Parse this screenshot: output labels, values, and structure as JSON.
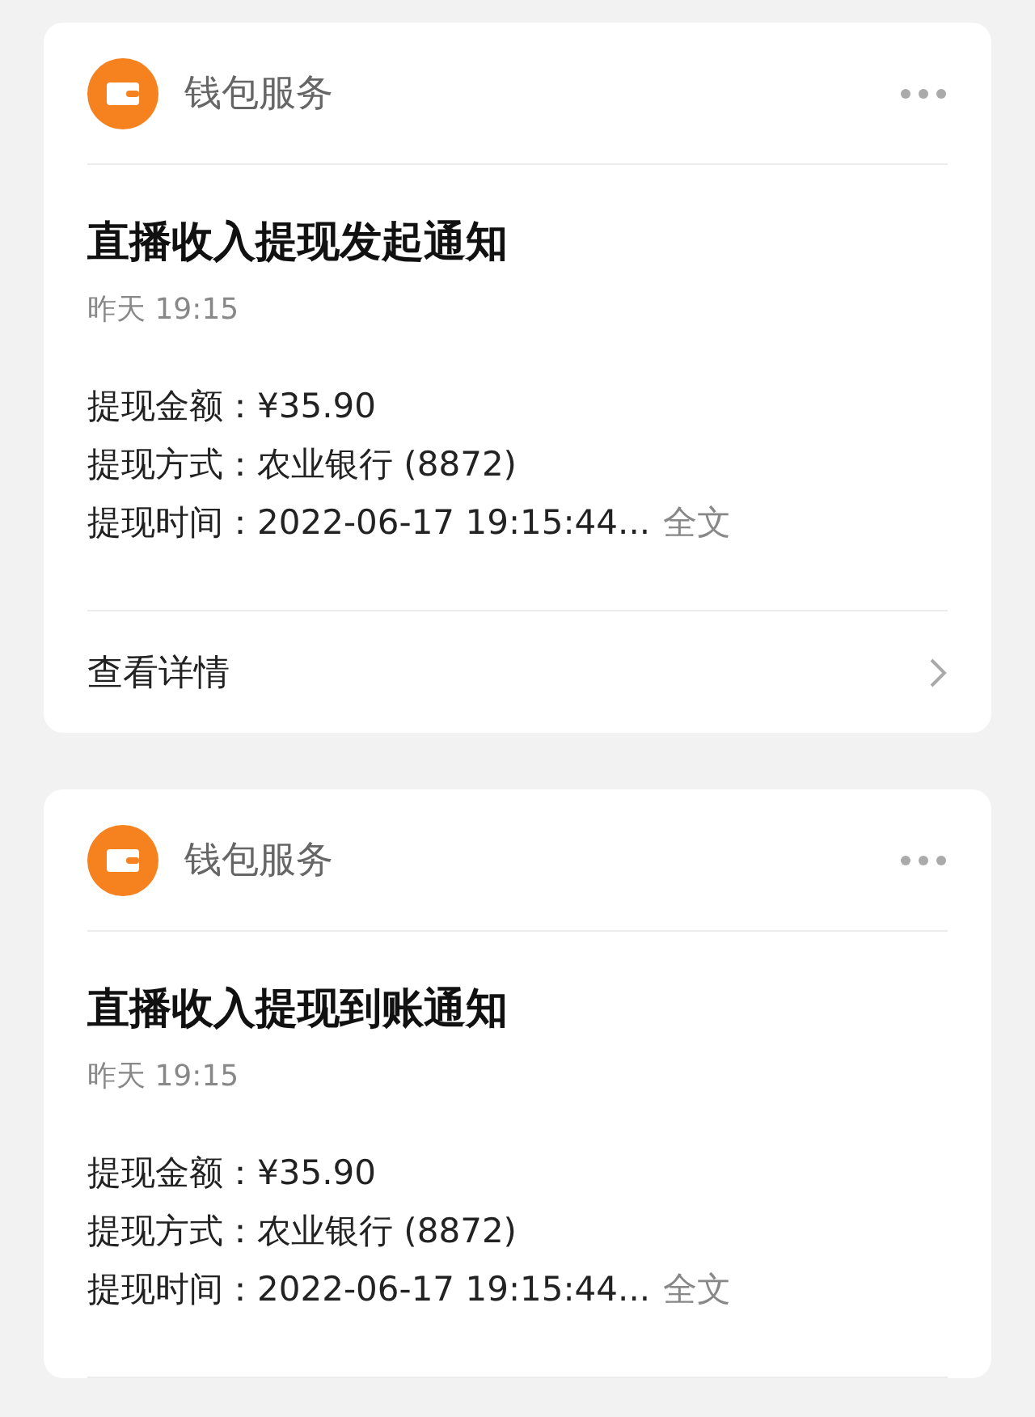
{
  "cards": [
    {
      "service": "钱包服务",
      "title": "直播收入提现发起通知",
      "time": "昨天 19:15",
      "fields": [
        {
          "label": "提现金额：",
          "value": "¥35.90"
        },
        {
          "label": "提现方式：",
          "value": "农业银行 (8872)"
        },
        {
          "label": "提现时间：",
          "value": "2022-06-17 19:15:44...",
          "more": "全文"
        }
      ],
      "footer": "查看详情"
    },
    {
      "service": "钱包服务",
      "title": "直播收入提现到账通知",
      "time": "昨天 19:15",
      "fields": [
        {
          "label": "提现金额：",
          "value": "¥35.90"
        },
        {
          "label": "提现方式：",
          "value": "农业银行 (8872)"
        },
        {
          "label": "提现时间：",
          "value": "2022-06-17 19:15:44...",
          "more": "全文"
        }
      ]
    }
  ]
}
